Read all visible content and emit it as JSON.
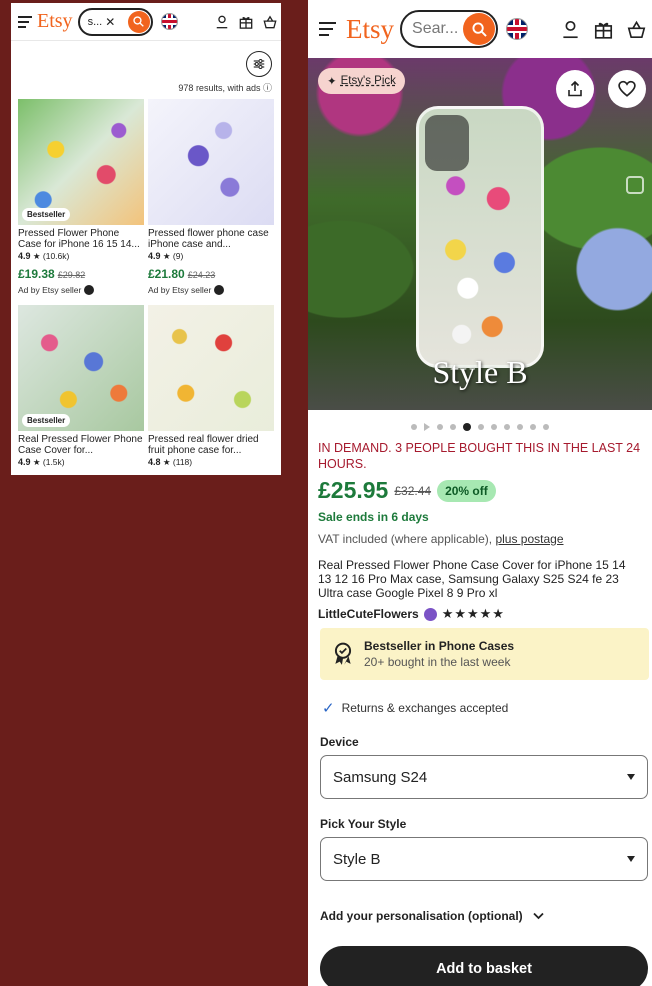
{
  "left": {
    "logo": "Etsy",
    "search_value": "s...",
    "results_text": "978 results, with ads",
    "products": [
      {
        "badge": "Bestseller",
        "title": "Pressed Flower Phone Case for iPhone 16 15 14...",
        "rating": "4.9",
        "reviews": "(10.6k)",
        "price": "£19.38",
        "old_price": "£29.82",
        "ad": "Ad by Etsy seller"
      },
      {
        "badge": "",
        "title": "Pressed flower phone case iPhone case and...",
        "rating": "4.9",
        "reviews": "(9)",
        "price": "£21.80",
        "old_price": "£24.23",
        "ad": "Ad by Etsy seller"
      },
      {
        "badge": "Bestseller",
        "title": "Real Pressed Flower Phone Case Cover for...",
        "rating": "4.9",
        "reviews": "(1.5k)",
        "price": "",
        "old_price": "",
        "ad": ""
      },
      {
        "badge": "",
        "title": "Pressed real flower dried fruit phone case for...",
        "rating": "4.8",
        "reviews": "(118)",
        "price": "",
        "old_price": "",
        "ad": ""
      }
    ]
  },
  "right": {
    "logo": "Etsy",
    "search_placeholder": "Sear...",
    "etsys_pick": "Etsy's Pick",
    "image_overlay_text": "Style B",
    "carousel": {
      "count": 11,
      "active_index": 4
    },
    "demand_text": "IN DEMAND. 3 PEOPLE BOUGHT THIS IN THE LAST 24 HOURS.",
    "price": "£25.95",
    "old_price": "£32.44",
    "discount": "20% off",
    "sale_ends": "Sale ends in 6 days",
    "vat_text": "VAT included (where applicable),",
    "postage_link": "plus postage",
    "product_title": "Real Pressed Flower Phone Case Cover for iPhone 15 14 13 12 16 Pro Max case, Samsung Galaxy S25 S24 fe 23 Ultra case Google Pixel 8 9 Pro xl",
    "shop_name": "LittleCuteFlowers",
    "shop_stars": "★★★★★",
    "bestseller_title": "Bestseller in Phone Cases",
    "bestseller_sub": "20+ bought in the last week",
    "returns": "Returns & exchanges accepted",
    "device_label": "Device",
    "device_value": "Samsung S24",
    "style_label": "Pick Your Style",
    "style_value": "Style B",
    "personalisation": "Add your personalisation (optional)",
    "add_to_basket": "Add to basket"
  },
  "colors": {
    "brand": "#f1641e",
    "price_green": "#1d7a3b",
    "demand_red": "#a61a2e",
    "page_bg": "#6a1e1b"
  }
}
